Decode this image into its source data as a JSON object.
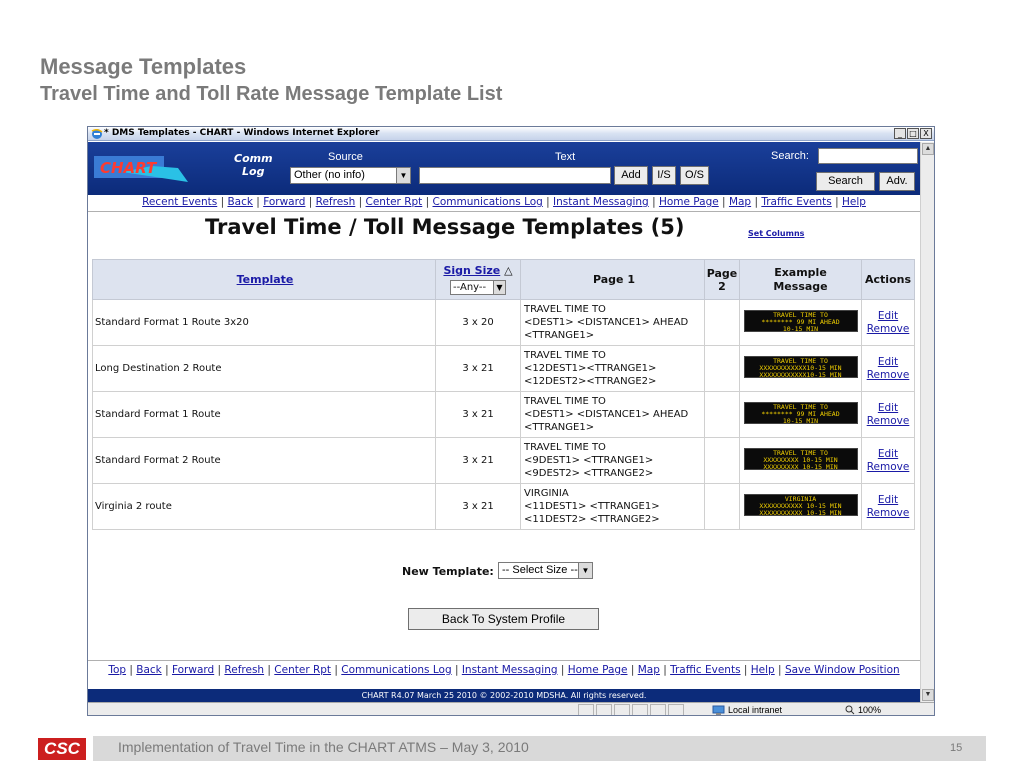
{
  "slide": {
    "title": "Message Templates",
    "subtitle": "Travel Time and Toll Rate Message Template List",
    "logo": "CSC",
    "footer": "Implementation of Travel Time in the CHART ATMS – May 3, 2010",
    "page_number": "15"
  },
  "window": {
    "title": "* DMS Templates - CHART - Windows Internet Explorer",
    "min": "_",
    "max": "□",
    "close": "X"
  },
  "header": {
    "comm_log_line1": "Comm",
    "comm_log_line2": "Log",
    "source_label": "Source",
    "source_value": "Other (no info)",
    "text_label": "Text",
    "add_label": "Add",
    "is_label": "I/S",
    "os_label": "O/S",
    "search_label": "Search:",
    "search_button": "Search",
    "adv_button": "Adv."
  },
  "nav": [
    "Recent Events",
    "Back",
    "Forward",
    "Refresh",
    "Center Rpt",
    "Communications Log",
    "Instant Messaging",
    "Home Page",
    "Map",
    "Traffic Events",
    "Help"
  ],
  "page": {
    "heading": "Travel Time / Toll Message Templates (5)",
    "set_columns": "Set Columns"
  },
  "table": {
    "headers": {
      "template": "Template",
      "sign_size": "Sign Size",
      "sort_indicator": "△",
      "sign_size_filter": "--Any--",
      "page1": "Page 1",
      "page2_line1": "Page",
      "page2_line2": "2",
      "example_line1": "Example",
      "example_line2": "Message",
      "actions": "Actions"
    },
    "edit_label": "Edit",
    "remove_label": "Remove",
    "rows": [
      {
        "template": "Standard Format 1 Route 3x20",
        "size": "3 x 20",
        "page1_l1": "TRAVEL TIME TO",
        "page1_l2": "<DEST1> <DISTANCE1> AHEAD",
        "page1_l3": "<TTRANGE1>",
        "page2": "",
        "example": "TRAVEL TIME TO\n******** 99 MI AHEAD\n10-15 MIN"
      },
      {
        "template": "Long Destination 2 Route",
        "size": "3 x 21",
        "page1_l1": "TRAVEL TIME TO",
        "page1_l2": "<12DEST1><TTRANGE1>",
        "page1_l3": "<12DEST2><TTRANGE2>",
        "page2": "",
        "example": "TRAVEL TIME TO\nXXXXXXXXXXXX10-15 MIN\nXXXXXXXXXXXX10-15 MIN"
      },
      {
        "template": "Standard Format 1 Route",
        "size": "3 x 21",
        "page1_l1": "TRAVEL TIME TO",
        "page1_l2": "<DEST1> <DISTANCE1> AHEAD",
        "page1_l3": "<TTRANGE1>",
        "page2": "",
        "example": "TRAVEL TIME TO\n******** 99 MI AHEAD\n10-15 MIN"
      },
      {
        "template": "Standard Format 2 Route",
        "size": "3 x 21",
        "page1_l1": "TRAVEL TIME TO",
        "page1_l2": "<9DEST1> <TTRANGE1>",
        "page1_l3": "<9DEST2> <TTRANGE2>",
        "page2": "",
        "example": "TRAVEL TIME TO\nXXXXXXXXX 10-15 MIN\nXXXXXXXXX 10-15 MIN"
      },
      {
        "template": "Virginia 2 route",
        "size": "3 x 21",
        "page1_l1": "VIRGINIA",
        "page1_l2": "<11DEST1> <TTRANGE1>",
        "page1_l3": "<11DEST2> <TTRANGE2>",
        "page2": "",
        "example": "VIRGINIA\nXXXXXXXXXXX 10-15 MIN\nXXXXXXXXXXX 10-15 MIN"
      }
    ]
  },
  "new_template": {
    "label": "New Template:",
    "select_value": "-- Select Size --"
  },
  "back_button": "Back To System Profile",
  "bottom_nav": [
    "Top",
    "Back",
    "Forward",
    "Refresh",
    "Center Rpt",
    "Communications Log",
    "Instant Messaging",
    "Home Page",
    "Map",
    "Traffic Events",
    "Help",
    "Save Window Position"
  ],
  "copyright": "CHART R4.07 March 25 2010     © 2002-2010 MDSHA. All rights reserved.",
  "status": {
    "zone": "Local intranet",
    "zoom": "100%"
  },
  "colors": {
    "chart_header_blue": "#0c2b7a",
    "link_blue": "#1a1aa6",
    "dms_amber": "#f2d000",
    "csc_red": "#cc1f1f"
  }
}
